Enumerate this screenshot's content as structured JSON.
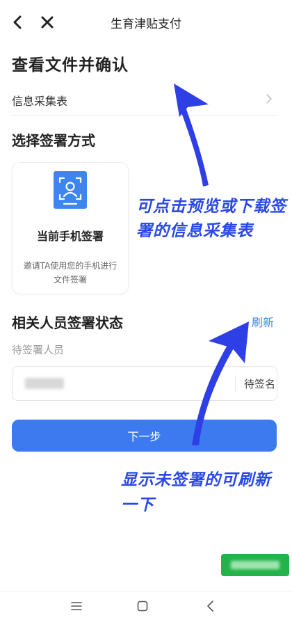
{
  "nav": {
    "title": "生育津贴支付",
    "back_icon": "back-arrow-icon",
    "close_icon": "close-icon"
  },
  "section_view": {
    "heading": "查看文件并确认",
    "file_row": {
      "label": "信息采集表",
      "chevron_icon": "chevron-right-icon"
    }
  },
  "section_sign": {
    "heading": "选择签署方式",
    "option": {
      "title": "当前手机签署",
      "description": "邀请TA使用您的手机进行文件签署",
      "icon": "face-scan-icon",
      "icon_color": "#3d86f0"
    }
  },
  "annotation_top": "可点击预览或下载签署的信息采集表",
  "section_status": {
    "heading": "相关人员签署状态",
    "refresh_label": "刷新",
    "pending_label": "待签署人员",
    "pending_row": {
      "status": "待签名"
    }
  },
  "next_button": "下一步",
  "annotation_bottom": "显示未签署的可刷新一下",
  "colors": {
    "accent": "#3d7af0",
    "annotation": "#2a48e8",
    "green": "#24b24a"
  },
  "system_nav": {
    "menu_icon": "menu-icon",
    "home_icon": "home-icon",
    "back_icon": "back-icon"
  }
}
